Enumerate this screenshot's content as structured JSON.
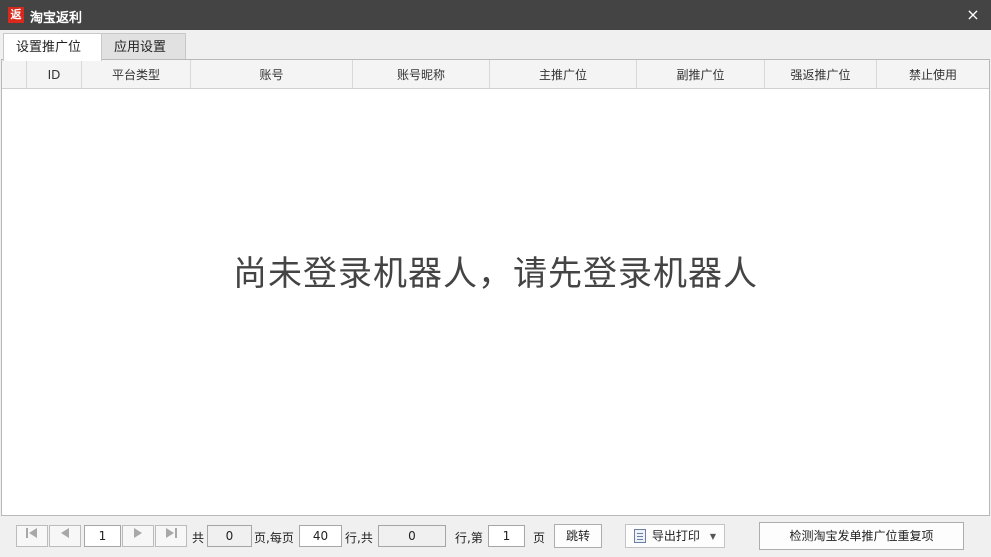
{
  "window": {
    "icon_char": "返",
    "title": "淘宝返利",
    "close_glyph": "×"
  },
  "tabs": [
    {
      "label": "设置推广位",
      "active": true
    },
    {
      "label": "应用设置",
      "active": false
    }
  ],
  "table": {
    "columns": [
      "",
      "ID",
      "平台类型",
      "账号",
      "账号昵称",
      "主推广位",
      "副推广位",
      "强返推广位",
      "禁止使用"
    ],
    "rows": [],
    "empty_message": "尚未登录机器人，请先登录机器人"
  },
  "pager": {
    "first_icon": "first-page-icon",
    "prev_icon": "prev-page-icon",
    "next_icon": "next-page-icon",
    "last_icon": "last-page-icon",
    "current_page": "1",
    "label_total": "共",
    "total_pages": "0",
    "label_per_page": "页,每页",
    "page_size": "40",
    "label_rows_total": "行,共",
    "total_rows": "0",
    "label_row_no": "行,第",
    "goto_page": "1",
    "label_page": "页",
    "jump_label": "跳转",
    "export_label": "导出打印",
    "check_label": "检测淘宝发单推广位重复项"
  }
}
